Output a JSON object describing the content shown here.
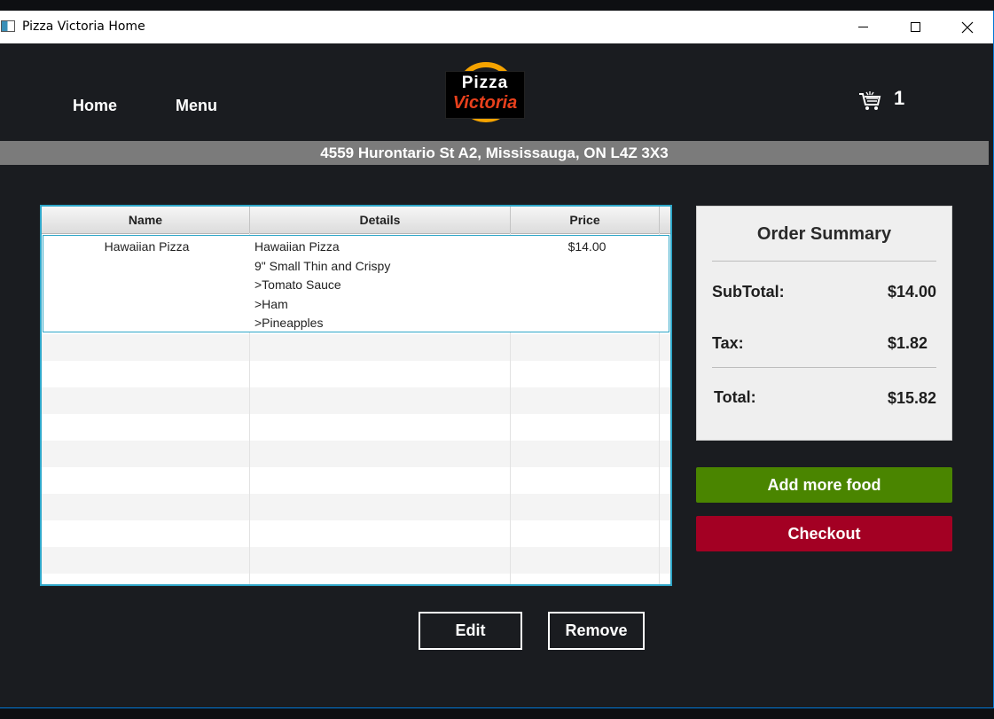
{
  "window": {
    "title": "Pizza Victoria Home"
  },
  "nav": {
    "home": "Home",
    "menu": "Menu"
  },
  "logo": {
    "line1": "Pizza",
    "line2": "Victoria"
  },
  "cart": {
    "count": "1",
    "icon": "cart-icon"
  },
  "address": "4559 Hurontario St A2, Mississauga, ON L4Z 3X3",
  "table": {
    "headers": {
      "name": "Name",
      "details": "Details",
      "price": "Price"
    },
    "rows": [
      {
        "name": "Hawaiian Pizza",
        "details": [
          "Hawaiian Pizza",
          "9\" Small Thin and Crispy",
          ">Tomato Sauce",
          ">Ham",
          ">Pineapples"
        ],
        "price": "$14.00"
      }
    ]
  },
  "summary": {
    "title": "Order Summary",
    "subtotal_label": "SubTotal:",
    "subtotal_value": "$14.00",
    "tax_label": "Tax:",
    "tax_value": "$1.82",
    "total_label": "Total:",
    "total_value": "$15.82"
  },
  "buttons": {
    "add_more": "Add more food",
    "checkout": "Checkout",
    "edit": "Edit",
    "remove": "Remove"
  },
  "colors": {
    "background": "#1a1c20",
    "add_button": "#4a8500",
    "checkout_button": "#a30023",
    "selection_border": "#2ea6c8",
    "logo_ring": "#f5a300",
    "logo_accent": "#e8401c"
  }
}
